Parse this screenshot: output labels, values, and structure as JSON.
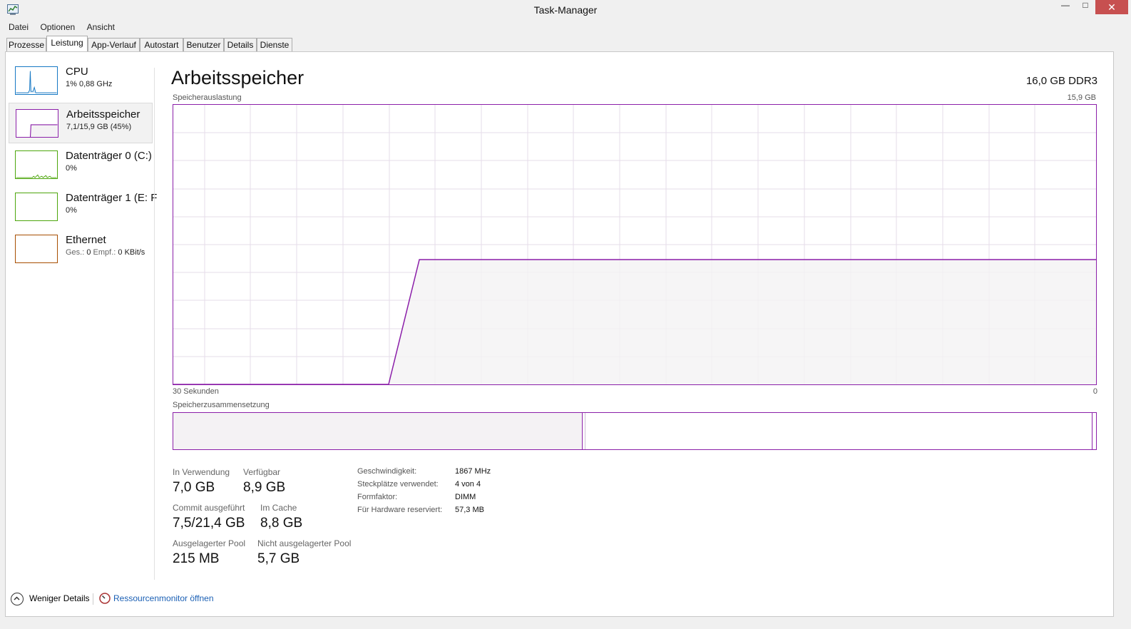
{
  "window": {
    "title": "Task-Manager",
    "minimize_glyph": "—",
    "maximize_glyph": "□",
    "close_glyph": "✕"
  },
  "menu": [
    "Datei",
    "Optionen",
    "Ansicht"
  ],
  "tabs": [
    {
      "label": "Prozesse",
      "active": false
    },
    {
      "label": "Leistung",
      "active": true
    },
    {
      "label": "App-Verlauf",
      "active": false
    },
    {
      "label": "Autostart",
      "active": false
    },
    {
      "label": "Benutzer",
      "active": false
    },
    {
      "label": "Details",
      "active": false
    },
    {
      "label": "Dienste",
      "active": false
    }
  ],
  "sidebar": {
    "items": [
      {
        "title": "CPU",
        "sub": "1% 0,88 GHz",
        "color": "#1779c4",
        "icon": "cpu-graph-icon"
      },
      {
        "title": "Arbeitsspeicher",
        "sub": "7,1/15,9 GB (45%)",
        "color": "#8b1fa9",
        "icon": "memory-graph-icon",
        "active": true
      },
      {
        "title": "Datenträger 0 (C:)",
        "sub": "0%",
        "color": "#4da60c",
        "icon": "disk-graph-icon"
      },
      {
        "title": "Datenträger 1 (E: F",
        "sub": "0%",
        "color": "#4da60c",
        "icon": "disk-graph-icon"
      },
      {
        "title": "Ethernet",
        "sub_parts": {
          "send_label": "Ges.:",
          "send_val": "0",
          "recv_label": "Empf.:",
          "recv_val": "0 KBit/s"
        },
        "color": "#a74f01",
        "icon": "network-graph-icon"
      }
    ]
  },
  "main": {
    "heading": "Arbeitsspeicher",
    "mem_type": "16,0 GB DDR3",
    "usage_label": "Speicherauslastung",
    "usage_max": "15,9 GB",
    "time_left": "30 Sekunden",
    "time_right": "0",
    "composition_label": "Speicherzusammensetzung",
    "stats": {
      "in_use_label": "In Verwendung",
      "in_use_val": "7,0 GB",
      "avail_label": "Verfügbar",
      "avail_val": "8,9 GB",
      "commit_label": "Commit ausgeführt",
      "commit_val": "7,5/21,4 GB",
      "cache_label": "Im Cache",
      "cache_val": "8,8 GB",
      "paged_label": "Ausgelagerter Pool",
      "paged_val": "215 MB",
      "nonpaged_label": "Nicht ausgelagerter Pool",
      "nonpaged_val": "5,7 GB"
    },
    "details": [
      {
        "label": "Geschwindigkeit:",
        "value": "1867 MHz"
      },
      {
        "label": "Steckplätze verwendet:",
        "value": "4 von 4"
      },
      {
        "label": "Formfaktor:",
        "value": "DIMM"
      },
      {
        "label": "Für Hardware reserviert:",
        "value": "57,3 MB"
      }
    ]
  },
  "footer": {
    "fewer_details": "Weniger Details",
    "resource_monitor": "Ressourcenmonitor öffnen"
  },
  "colors": {
    "memory": "#8b1fa9",
    "memory_fill": "#f4f2f4",
    "grid": "#e6dcea"
  },
  "chart_data": {
    "type": "area",
    "title": "Speicherauslastung",
    "xlabel_left": "30 Sekunden",
    "xlabel_right": "0",
    "ylim": [
      0,
      15.9
    ],
    "unit": "GB",
    "x_seconds_ago": [
      30,
      23,
      22,
      0
    ],
    "values": [
      0,
      0,
      7.1,
      7.1
    ]
  }
}
